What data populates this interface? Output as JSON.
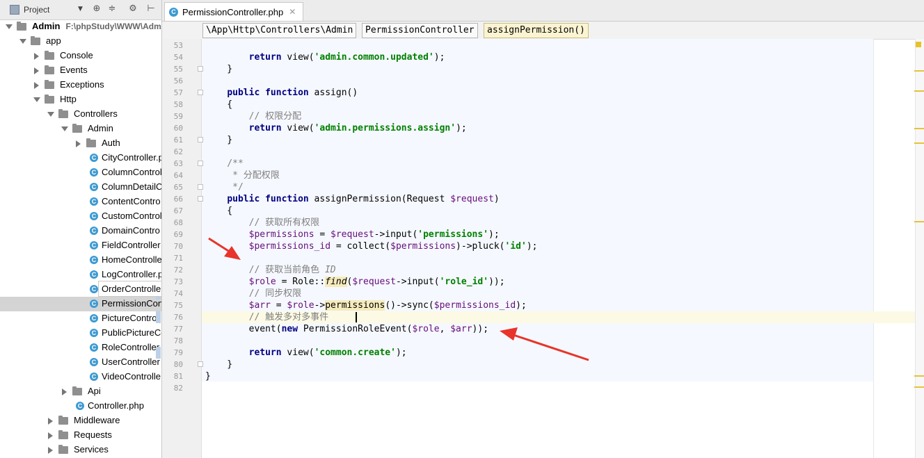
{
  "project": {
    "title": "Project",
    "tree": [
      {
        "label": "Admin",
        "path": "F:\\phpStudy\\WWW\\Adm",
        "type": "folder",
        "open": true,
        "depth": 0,
        "bold": true
      },
      {
        "label": "app",
        "type": "folder",
        "open": true,
        "depth": 1
      },
      {
        "label": "Console",
        "type": "folder",
        "open": false,
        "depth": 2
      },
      {
        "label": "Events",
        "type": "folder",
        "open": false,
        "depth": 2
      },
      {
        "label": "Exceptions",
        "type": "folder",
        "open": false,
        "depth": 2
      },
      {
        "label": "Http",
        "type": "folder",
        "open": true,
        "depth": 2
      },
      {
        "label": "Controllers",
        "type": "folder",
        "open": true,
        "depth": 3
      },
      {
        "label": "Admin",
        "type": "folder",
        "open": true,
        "depth": 4
      },
      {
        "label": "Auth",
        "type": "folder",
        "open": false,
        "depth": 5
      },
      {
        "label": "CityController.p",
        "type": "class",
        "depth": 6
      },
      {
        "label": "ColumnControl",
        "type": "class",
        "depth": 6
      },
      {
        "label": "ColumnDetailC",
        "type": "class",
        "depth": 6
      },
      {
        "label": "ContentContro",
        "type": "class",
        "depth": 6
      },
      {
        "label": "CustomControl",
        "type": "class",
        "depth": 6
      },
      {
        "label": "DomainContro",
        "type": "class",
        "depth": 6
      },
      {
        "label": "FieldController",
        "type": "class",
        "depth": 6
      },
      {
        "label": "HomeControlle",
        "type": "class",
        "depth": 6
      },
      {
        "label": "LogController.p",
        "type": "class",
        "depth": 6
      },
      {
        "label": "OrderController.php",
        "type": "class",
        "depth": 6
      },
      {
        "label": "PermissionCon",
        "type": "class",
        "depth": 6,
        "selected": true
      },
      {
        "label": "PictureControll",
        "type": "class",
        "depth": 6
      },
      {
        "label": "PublicPictureCo",
        "type": "class",
        "depth": 6
      },
      {
        "label": "RoleController.",
        "type": "class",
        "depth": 6
      },
      {
        "label": "UserController",
        "type": "class",
        "depth": 6
      },
      {
        "label": "VideoControlle",
        "type": "class",
        "depth": 6
      },
      {
        "label": "Api",
        "type": "folder",
        "open": false,
        "depth": 4
      },
      {
        "label": "Controller.php",
        "type": "class",
        "depth": 5
      },
      {
        "label": "Middleware",
        "type": "folder",
        "open": false,
        "depth": 3
      },
      {
        "label": "Requests",
        "type": "folder",
        "open": false,
        "depth": 3
      },
      {
        "label": "Services",
        "type": "folder",
        "open": false,
        "depth": 3
      }
    ],
    "tooltip": "OrderController.php"
  },
  "editor": {
    "tab_label": "PermissionController.php",
    "breadcrumbs": [
      "\\App\\Http\\Controllers\\Admin",
      "PermissionController",
      "assignPermission()"
    ],
    "lines": [
      {
        "n": "53",
        "t": ""
      },
      {
        "n": "54",
        "t": "        return view('admin.common.updated');"
      },
      {
        "n": "55",
        "t": "    }"
      },
      {
        "n": "56",
        "t": ""
      },
      {
        "n": "57",
        "t": "    public function assign()"
      },
      {
        "n": "58",
        "t": "    {"
      },
      {
        "n": "59",
        "t": "        // 权限分配"
      },
      {
        "n": "60",
        "t": "        return view('admin.permissions.assign');"
      },
      {
        "n": "61",
        "t": "    }"
      },
      {
        "n": "62",
        "t": ""
      },
      {
        "n": "63",
        "t": "    /**"
      },
      {
        "n": "64",
        "t": "     * 分配权限"
      },
      {
        "n": "65",
        "t": "     */"
      },
      {
        "n": "66",
        "t": "    public function assignPermission(Request $request)"
      },
      {
        "n": "67",
        "t": "    {"
      },
      {
        "n": "68",
        "t": "        // 获取所有权限"
      },
      {
        "n": "69",
        "t": "        $permissions = $request->input('permissions');"
      },
      {
        "n": "70",
        "t": "        $permissions_id = collect($permissions)->pluck('id');"
      },
      {
        "n": "71",
        "t": ""
      },
      {
        "n": "72",
        "t": "        // 获取当前角色 ID"
      },
      {
        "n": "73",
        "t": "        $role = Role::find($request->input('role_id'));"
      },
      {
        "n": "74",
        "t": "        // 同步权限"
      },
      {
        "n": "75",
        "t": "        $arr = $role->permissions()->sync($permissions_id);"
      },
      {
        "n": "76",
        "t": "        // 触发多对多事件"
      },
      {
        "n": "77",
        "t": "        event(new PermissionRoleEvent($role, $arr));"
      },
      {
        "n": "78",
        "t": ""
      },
      {
        "n": "79",
        "t": "        return view('common.create');"
      },
      {
        "n": "80",
        "t": "    }"
      },
      {
        "n": "81",
        "t": "}"
      },
      {
        "n": "82",
        "t": ""
      }
    ]
  },
  "colors": {
    "keyword": "#000080",
    "string": "#008000",
    "variable": "#660e7a",
    "comment": "#808080",
    "annotation_arrow": "#e8342a"
  }
}
